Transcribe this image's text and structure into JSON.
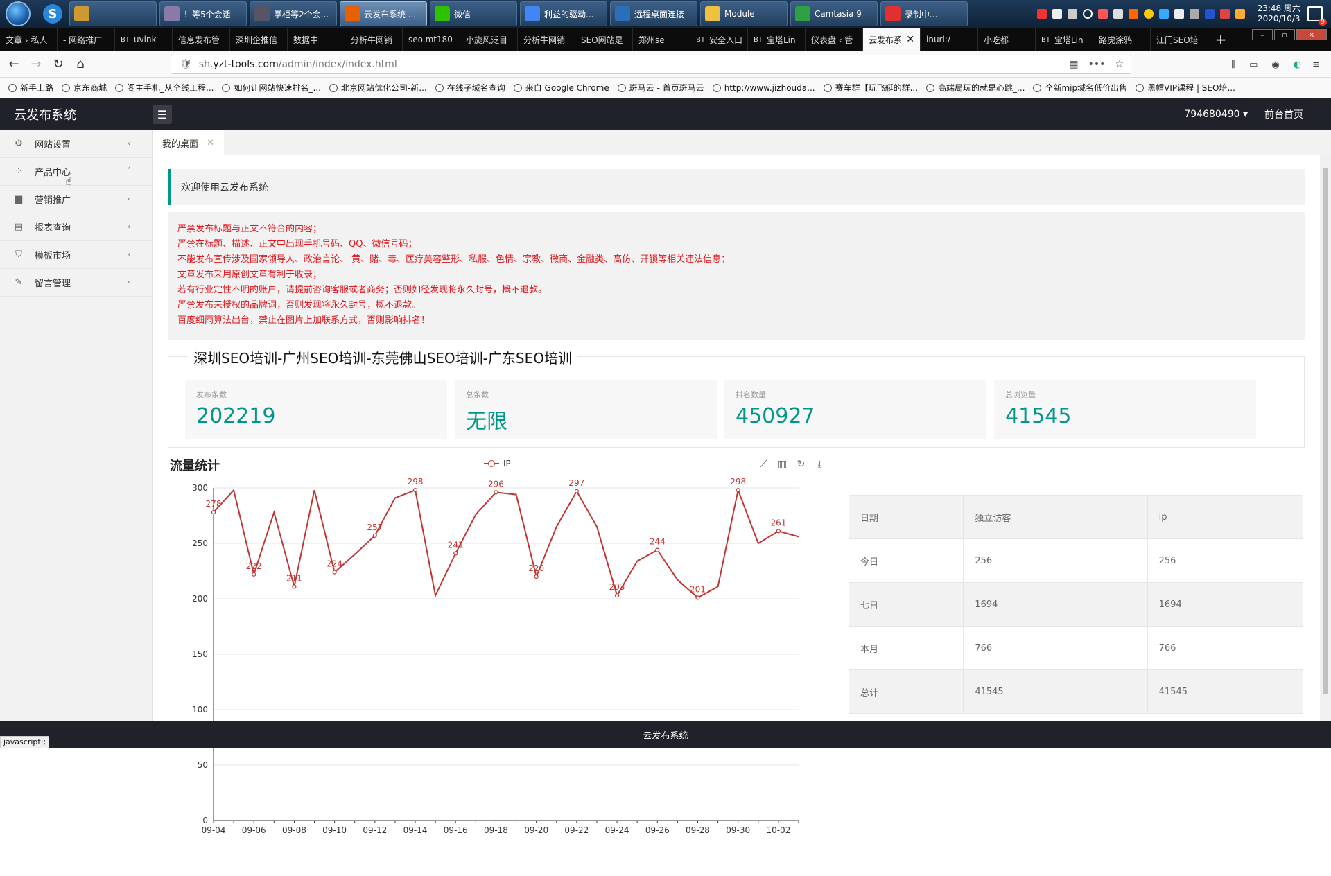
{
  "taskbar": {
    "items": [
      {
        "label": "",
        "color": "#c93"
      },
      {
        "label": "！等5个会话",
        "color": "#8a7aa8"
      },
      {
        "label": "掌柜等2个会...",
        "color": "#556"
      },
      {
        "label": "云发布系统 ...",
        "color": "#e66000",
        "active": true
      },
      {
        "label": "微信",
        "color": "#2dc100"
      },
      {
        "label": "利益的驱动...",
        "color": "#4285f4"
      },
      {
        "label": "远程桌面连接",
        "color": "#2a6fb8"
      },
      {
        "label": "Module",
        "color": "#f0c040"
      },
      {
        "label": "Camtasia 9",
        "color": "#2ea043"
      },
      {
        "label": "录制中...",
        "color": "#e03030"
      }
    ],
    "clock_time": "23:48 周六",
    "clock_date": "2020/10/3",
    "notif_count": "9"
  },
  "browser": {
    "tabs": [
      "文章 › 私人",
      "- 网络推广",
      "uvink",
      "信息发布管",
      "深圳企推信",
      "数据中",
      "分析牛网销",
      "seo.mt180",
      "小旋风泛目",
      "分析牛网销",
      "SEO网站是",
      "郑州se",
      "安全入口",
      "宝塔Lin",
      "仪表盘 ‹ 管",
      "云发布系",
      "inurl:/",
      "小吃都",
      "宝塔Lin",
      "路虎涂鸦",
      "江门SEO培"
    ],
    "tab_prefixes": [
      "",
      "",
      "BT",
      "",
      "",
      "",
      "",
      "",
      "",
      "",
      "",
      "",
      "BT",
      "BT",
      "",
      "",
      "",
      "",
      "BT",
      "",
      ""
    ],
    "active_tab": 15,
    "url_prefix": "sh.",
    "url_domain": "yzt-tools.com",
    "url_path": "/admin/index/index.html",
    "bookmarks": [
      "新手上路",
      "京东商城",
      "阁主手札_从全线工程...",
      "如何让网站快速排名_...",
      "北京网站优化公司-新...",
      "在线子域名查询",
      "来自 Google Chrome",
      "斑马云 - 首页斑马云",
      "http://www.jizhouda...",
      "赛车群【玩飞艇的群...",
      "高端局玩的就是心跳_...",
      "全新mip域名低价出售",
      "黑帽VIP课程 | SEO培..."
    ]
  },
  "app": {
    "title": "云发布系统",
    "user": "794680490",
    "home_link": "前台首页",
    "footer": "云发布系统"
  },
  "sidebar": {
    "items": [
      {
        "label": "网站设置",
        "icon": "gear-icon",
        "chev": "‹"
      },
      {
        "label": "产品中心",
        "icon": "grid-icon",
        "chev": "˅"
      },
      {
        "label": "营销推广",
        "icon": "chart-icon",
        "chev": "‹"
      },
      {
        "label": "报表查询",
        "icon": "report-icon",
        "chev": "‹"
      },
      {
        "label": "模板市场",
        "icon": "shirt-icon",
        "chev": "‹"
      },
      {
        "label": "留言管理",
        "icon": "pen-icon",
        "chev": "‹"
      }
    ]
  },
  "content": {
    "tab": "我的桌面",
    "welcome": "欢迎使用云发布系统",
    "notices": [
      "严禁发布标题与正文不符合的内容；",
      "严禁在标题、描述、正文中出现手机号码、QQ、微信号码；",
      "不能发布宣传涉及国家领导人、政治言论、 黄、赌、毒、医疗美容整形、私服、色情、宗教、微商、金融类、高仿、开锁等相关违法信息；",
      "文章发布采用原创文章有利于收录；",
      "若有行业定性不明的账户，请提前咨询客服或者商务；否则如经发现将永久封号，概不退款。",
      "严禁发布未授权的品牌词，否则发现将永久封号，概不退款。",
      "百度细雨算法出台，禁止在图片上加联系方式，否则影响排名！"
    ],
    "site_title": "深圳SEO培训-广州SEO培训-东莞佛山SEO培训-广东SEO培训",
    "stats": [
      {
        "label": "发布条数",
        "value": "202219"
      },
      {
        "label": "总条数",
        "value": "无限"
      },
      {
        "label": "排名数量",
        "value": "450927"
      },
      {
        "label": "总浏览量",
        "value": "41545"
      }
    ],
    "traffic_title": "流量统计"
  },
  "chart_data": {
    "type": "line",
    "legend": [
      "IP"
    ],
    "x": [
      "09-04",
      "09-05",
      "09-06",
      "09-07",
      "09-08",
      "09-09",
      "09-10",
      "09-11",
      "09-12",
      "09-13",
      "09-14",
      "09-15",
      "09-16",
      "09-17",
      "09-18",
      "09-19",
      "09-20",
      "09-21",
      "09-22",
      "09-23",
      "09-24",
      "09-25",
      "09-26",
      "09-27",
      "09-28",
      "09-29",
      "09-30",
      "10-01",
      "10-02",
      "10-03"
    ],
    "series": [
      {
        "name": "IP",
        "values": [
          278,
          298,
          222,
          278,
          211,
          298,
          224,
          240,
          257,
          291,
          298,
          203,
          241,
          276,
          296,
          294,
          220,
          265,
          297,
          265,
          203,
          234,
          244,
          217,
          201,
          211,
          298,
          250,
          261,
          256
        ]
      }
    ],
    "labeled_indices": [
      0,
      2,
      4,
      6,
      8,
      10,
      12,
      14,
      16,
      18,
      20,
      22,
      24,
      26,
      28
    ],
    "ylim": [
      0,
      300
    ],
    "yticks": [
      0,
      50,
      100,
      150,
      200,
      250,
      300
    ],
    "xticks_shown": [
      "09-04",
      "09-06",
      "09-08",
      "09-10",
      "09-12",
      "09-14",
      "09-16",
      "09-18",
      "09-20",
      "09-22",
      "09-24",
      "09-26",
      "09-28",
      "09-30",
      "10-02"
    ],
    "color": "#c23531"
  },
  "table": {
    "headers": [
      "日期",
      "独立访客",
      "ip"
    ],
    "rows": [
      [
        "今日",
        "256",
        "256"
      ],
      [
        "七日",
        "1694",
        "1694"
      ],
      [
        "本月",
        "766",
        "766"
      ],
      [
        "总计",
        "41545",
        "41545"
      ]
    ]
  },
  "statusbar": "javascript:;"
}
